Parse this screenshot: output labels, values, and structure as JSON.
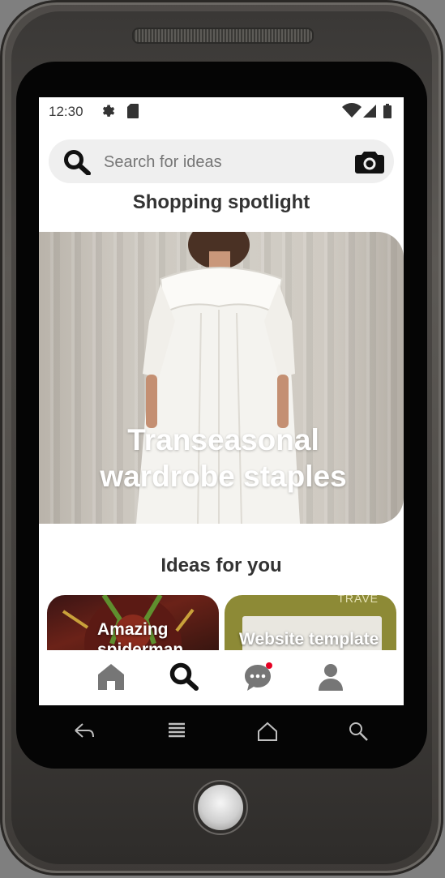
{
  "status_bar": {
    "time": "12:30"
  },
  "search": {
    "placeholder": "Search for ideas"
  },
  "spotlight": {
    "heading": "Shopping spotlight",
    "title_line1": "Transeasonal",
    "title_line2": "wardrobe staples"
  },
  "ideas": {
    "heading": "Ideas for you",
    "cards": [
      {
        "label_line1": "Amazing",
        "label_line2": "spiderman"
      },
      {
        "label_line1": "Website template",
        "corner_text": "TRAVE"
      }
    ]
  },
  "bottom_nav": {
    "items": [
      "home-icon",
      "search-icon",
      "messages-icon",
      "profile-icon"
    ],
    "active": "search-icon",
    "notification_color": "#e60023"
  },
  "android_keys": [
    "back-icon",
    "menu-icon",
    "home-icon",
    "search-icon"
  ]
}
